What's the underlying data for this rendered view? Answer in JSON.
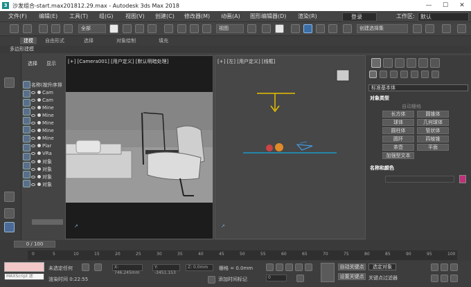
{
  "window": {
    "title": "沙发组合-start.max201812.29.max - Autodesk 3ds Max 2018",
    "min": "—",
    "max": "☐",
    "close": "✕"
  },
  "menu": [
    {
      "label": "文件(F)"
    },
    {
      "label": "编辑(E)"
    },
    {
      "label": "工具(T)"
    },
    {
      "label": "组(G)"
    },
    {
      "label": "视图(V)"
    },
    {
      "label": "创建(C)"
    },
    {
      "label": "修改器(M)"
    },
    {
      "label": "动画(A)"
    },
    {
      "label": "图形编辑器(D)"
    },
    {
      "label": "渲染(R)"
    },
    {
      "label": "登录"
    },
    {
      "label": "工作区:"
    },
    {
      "label": "默认"
    }
  ],
  "toolbar": {
    "filter": "全部",
    "view": "视图",
    "selection_set": "创建选择集"
  },
  "ribbon": {
    "tabs": [
      "建模",
      "自由形式",
      "选择",
      "对象绘制",
      "填充"
    ],
    "sub": "多边形建模"
  },
  "scene_explorer": {
    "tabs": [
      "选择",
      "显示"
    ],
    "column": "名称(按升序排",
    "rows": [
      "Cam",
      "Cam",
      "Mine",
      "Mine",
      "Mine",
      "Mine",
      "Mine",
      "Plar",
      "VRa",
      "对象",
      "对象",
      "对象",
      "对象"
    ]
  },
  "viewport1": {
    "label": "[+] [Camera001] [用户定义] [默认明暗处理]"
  },
  "viewport2": {
    "label": "[+] [左] [用户定义] [线框]"
  },
  "command_panel": {
    "dropdown": "标准基本体",
    "section1": "对象类型",
    "autogrid": "自动栅格",
    "buttons": [
      "长方体",
      "圆锥体",
      "球体",
      "几何球体",
      "圆柱体",
      "管状体",
      "圆环",
      "四棱锥",
      "茶壶",
      "平面",
      "加强型文本"
    ],
    "section2": "名称和颜色",
    "color_swatch": "#c0307a"
  },
  "timeline": {
    "frame": "0 / 100",
    "ticks": [
      "0",
      "5",
      "10",
      "15",
      "20",
      "25",
      "30",
      "35",
      "40",
      "45",
      "50",
      "55",
      "60",
      "65",
      "70",
      "75",
      "80",
      "85",
      "90",
      "95",
      "100"
    ]
  },
  "status": {
    "script": "MAXScript 迷",
    "selection": "未选定任何",
    "render_time": "渲染时间 0:22:55",
    "x": "X: 746.245mm",
    "y": "Y: -3451.153",
    "z": "Z: 0.0mm",
    "grid": "栅格 = 0.0mm",
    "add_tag": "添加时间标记",
    "auto_key": "自动关键点",
    "set_key": "设置关键点",
    "selected": "选定对象",
    "filter": "关键点过滤器",
    "frame_num": "0"
  }
}
